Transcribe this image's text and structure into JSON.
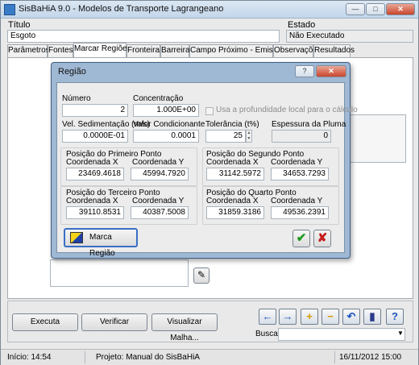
{
  "app": {
    "title": "SisBaHiA 9.0 - Modelos de Transporte Lagrangeano"
  },
  "header": {
    "titulo_label": "Título",
    "titulo_value": "Esgoto",
    "estado_label": "Estado",
    "estado_value": "Não Executado"
  },
  "tabs": [
    "Parâmetros",
    "Fontes",
    "Marcar Regiões",
    "Fronteira",
    "Barreira",
    "Campo Próximo - Emissários",
    "Observações",
    "Resultados"
  ],
  "bottom": {
    "executa": "Executa",
    "verificar": "Verificar",
    "visualizar": "Visualizar Malha...",
    "busca_label": "Busca:",
    "busca_value": ""
  },
  "status": {
    "inicio": "Início: 14:54",
    "projeto": "Projeto: Manual do SisBaHiA",
    "data": "16/11/2012 15:00"
  },
  "dialog": {
    "title": "Região",
    "numero_label": "Número",
    "numero_value": "2",
    "concentracao_label": "Concentração",
    "concentracao_value": "1.000E+00",
    "usa_prof_label": "Usa a profundidade local para o cálculo",
    "vel_sed_label": "Vel. Sedimentação (m/s)",
    "vel_sed_value": "0.0000E-01",
    "valor_cond_label": "Valor Condicionante",
    "valor_cond_value": "0.0001",
    "tolerancia_label": "Tolerância (t%)",
    "tolerancia_value": "25",
    "espessura_label": "Espessura da Pluma",
    "espessura_value": "0",
    "coord_x_label": "Coordenada X",
    "coord_y_label": "Coordenada Y",
    "p1": {
      "title": "Posição do Primeiro Ponto",
      "x": "23469.4618",
      "y": "45994.7920"
    },
    "p2": {
      "title": "Posição do Segundo Ponto",
      "x": "31142.5972",
      "y": "34653.7293"
    },
    "p3": {
      "title": "Posição do Terceiro Ponto",
      "x": "39110.8531",
      "y": "40387.5008"
    },
    "p4": {
      "title": "Posição do Quarto Ponto",
      "x": "31859.3186",
      "y": "49536.2391"
    },
    "marca_regiao": "Marca Região"
  }
}
